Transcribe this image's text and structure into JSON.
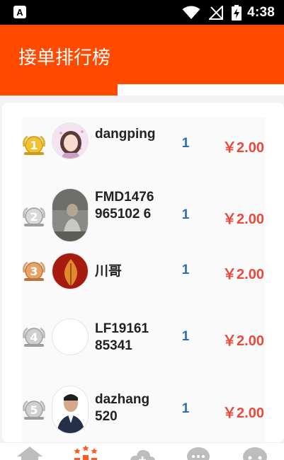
{
  "status_bar": {
    "time": "4:38",
    "icons": [
      "notification-a-icon",
      "wifi-icon",
      "no-signal-icon",
      "battery-charging-icon"
    ]
  },
  "header": {
    "title": "接单排行榜"
  },
  "colors": {
    "accent": "#ff4a00",
    "count": "#2d6db5",
    "money": "#e84a3c"
  },
  "ranking": [
    {
      "rank": "1",
      "name": "dangping",
      "count": "1",
      "amount": "￥2.00",
      "medal": "gold"
    },
    {
      "rank": "2",
      "name": "FMD1476965102 6",
      "count": "1",
      "amount": "￥2.00",
      "medal": "silver"
    },
    {
      "rank": "3",
      "name": "川哥",
      "count": "1",
      "amount": "￥2.00",
      "medal": "bronze"
    },
    {
      "rank": "4",
      "name": "LF1916185341",
      "count": "1",
      "amount": "￥2.00",
      "medal": "plain"
    },
    {
      "rank": "5",
      "name": "dazhang520",
      "count": "1",
      "amount": "￥2.00",
      "medal": "plain"
    }
  ],
  "bottom_nav": {
    "items": [
      "home-icon",
      "ranking-icon",
      "cloud-add-icon",
      "chat-icon",
      "message-icon"
    ]
  }
}
